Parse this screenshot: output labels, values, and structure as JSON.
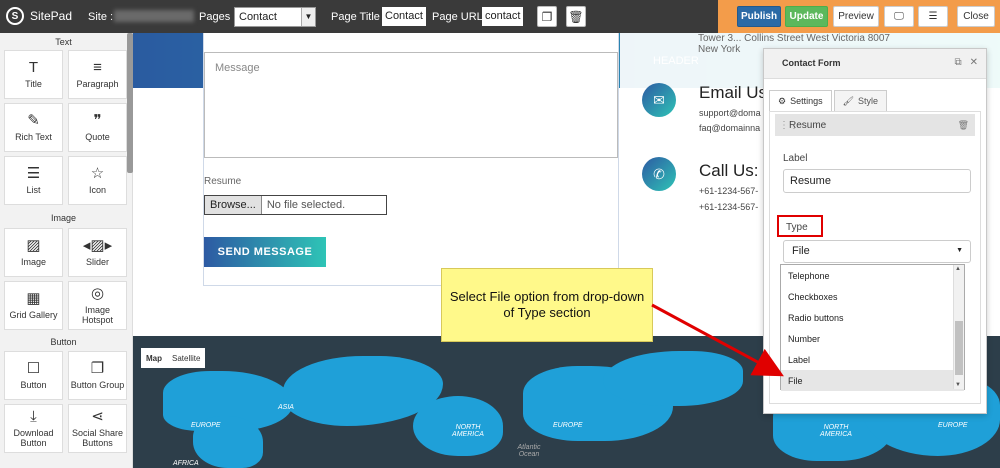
{
  "topbar": {
    "app_name": "SitePad",
    "site_label": "Site :",
    "pages_label": "Pages :",
    "pages_value": "Contact",
    "page_title_label": "Page Title :",
    "page_title_value": "Contact",
    "page_url_label": "Page URL :",
    "page_url_value": "contact",
    "publish": "Publish",
    "update": "Update",
    "preview": "Preview",
    "close": "Close"
  },
  "sidebar": {
    "sections": {
      "text": "Text",
      "image": "Image",
      "button": "Button"
    },
    "text_items": [
      "Title",
      "Paragraph",
      "Rich Text",
      "Quote",
      "List",
      "Icon"
    ],
    "image_items": [
      "Image",
      "Slider",
      "Grid Gallery",
      "Image Hotspot"
    ],
    "button_items": [
      "Button",
      "Button Group",
      "Download Button",
      "Social Share Buttons"
    ]
  },
  "canvas": {
    "header_text": "HEADER",
    "address_line": "Tower 3... Collins Street West Victoria 8007",
    "address_city": "New York",
    "message_placeholder": "Message",
    "resume_label": "Resume",
    "browse_label": "Browse...",
    "no_file": "No file selected.",
    "send_message": "SEND MESSAGE",
    "email_title": "Email Us",
    "email_1": "support@doma",
    "email_2": "faq@domainna",
    "call_title": "Call Us:",
    "phone_1": "+61-1234-567-",
    "phone_2": "+61-1234-567-",
    "map_tab_map": "Map",
    "map_tab_satellite": "Satellite",
    "map_labels": [
      "ASIA",
      "EUROPE",
      "NORTH AMERICA",
      "AFRICA",
      "Atlantic Ocean",
      "EUROPE",
      "NORTH AMERICA",
      "EUROPE"
    ]
  },
  "panel": {
    "title": "Contact Form",
    "tab_settings": "Settings",
    "tab_style": "Style",
    "field_row": "Resume",
    "label_caption": "Label",
    "label_value": "Resume",
    "type_caption": "Type",
    "type_value": "File",
    "options": [
      "Telephone",
      "Checkboxes",
      "Radio buttons",
      "Number",
      "Label",
      "File"
    ],
    "selected_option": "File"
  },
  "callout": {
    "text": "Select File option from drop-down of Type section"
  },
  "colors": {
    "topbar": "#3a3a3a",
    "accent_orange": "#f39c4a",
    "publish_blue": "#2b6aa6",
    "update_green": "#5cb85c",
    "highlight_red": "#e00000",
    "callout_yellow": "#fff98a",
    "gradient_start": "#2d5aa3",
    "gradient_end": "#2ec4b6",
    "map_water": "#2d3e4a",
    "map_land": "#1fa0d8"
  }
}
